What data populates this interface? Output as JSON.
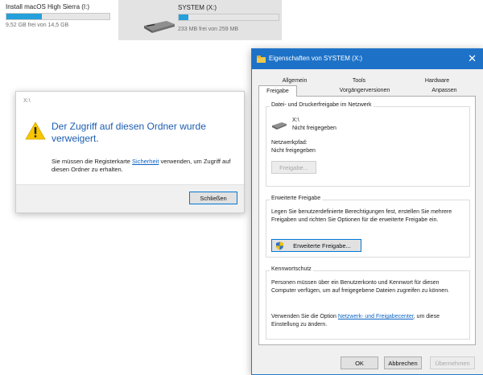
{
  "drives": [
    {
      "name": "Install macOS High Sierra (I:)",
      "free": "9,52 GB frei von 14,5 GB",
      "used_fraction": 0.34
    },
    {
      "name": "SYSTEM (X:)",
      "free": "233 MB frei von 259 MB",
      "used_fraction": 0.1
    }
  ],
  "error_dialog": {
    "title": "X:\\",
    "headline": "Der Zugriff auf diesen Ordner wurde verweigert.",
    "message_before": "Sie müssen die Registerkarte ",
    "message_link": "Sicherheit",
    "message_after": " verwenden, um Zugriff auf diesen Ordner zu erhalten.",
    "close_label": "Schließen"
  },
  "properties_dialog": {
    "title": "Eigenschaften von SYSTEM (X:)",
    "tabs_row1": [
      "Allgemein",
      "Tools",
      "Hardware"
    ],
    "tabs_row2": [
      "Freigabe",
      "Vorgängerversionen",
      "Anpassen"
    ],
    "active_tab": "Freigabe",
    "sharing": {
      "group_title": "Datei- und Druckerfreigabe im Netzwerk",
      "path": "X:\\",
      "status": "Nicht freigegeben",
      "network_path_label": "Netzwerkpfad:",
      "network_path_value": "Nicht freigegeben",
      "share_button": "Freigabe..."
    },
    "advanced": {
      "group_title": "Erweiterte Freigabe",
      "text": "Legen Sie benutzerdefinierte Berechtigungen fest, erstellen Sie mehrere Freigaben und richten Sie Optionen für die erweiterte Freigabe ein.",
      "button": "Erweiterte Freigabe..."
    },
    "password": {
      "group_title": "Kennwortschutz",
      "text": "Personen müssen über ein Benutzerkonto und Kennwort für diesen Computer verfügen, um auf freigegebene Dateien zugreifen zu können.",
      "text2_before": "Verwenden Sie die Option ",
      "text2_link": "Netzwerk- und Freigabecenter",
      "text2_after": ", um diese Einstellung zu ändern."
    },
    "buttons": {
      "ok": "OK",
      "cancel": "Abbrechen",
      "apply": "Übernehmen"
    }
  },
  "colors": {
    "accent": "#1d72c8",
    "warning": "#f7c600",
    "link": "#0a63c4",
    "drive_bar": "#26a0da"
  },
  "icons": [
    "drive-icon",
    "usb-drive-icon",
    "warning-icon",
    "folder-properties-icon",
    "close-icon",
    "share-drive-icon",
    "shield-icon"
  ]
}
